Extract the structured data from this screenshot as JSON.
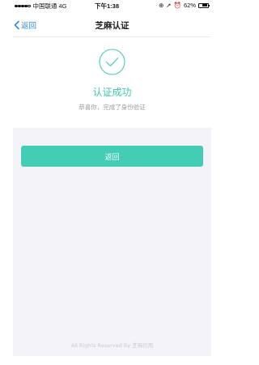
{
  "status_bar": {
    "carrier": "中国联通",
    "network": "4G",
    "time": "下午1:38",
    "battery": "62%",
    "battery_level": 0.62,
    "signal_bars_filled": 4,
    "signal_bars_total": 5
  },
  "nav": {
    "back_label": "返回",
    "title": "芝麻认证"
  },
  "result": {
    "title": "认证成功",
    "subtitle": "恭喜你，完成了身份验证"
  },
  "actions": {
    "return_label": "返回"
  },
  "footer": {
    "text": "All Rights Reserved By 芝麻信用"
  },
  "colors": {
    "accent": "#43cdb5",
    "link": "#2f8bdb",
    "background": "#f4f4f8"
  },
  "icons": {
    "back": "chevron-left-icon",
    "success": "check-circle-icon",
    "alarm": "alarm-icon",
    "location": "location-arrow-icon",
    "lock": "rotation-lock-icon"
  }
}
